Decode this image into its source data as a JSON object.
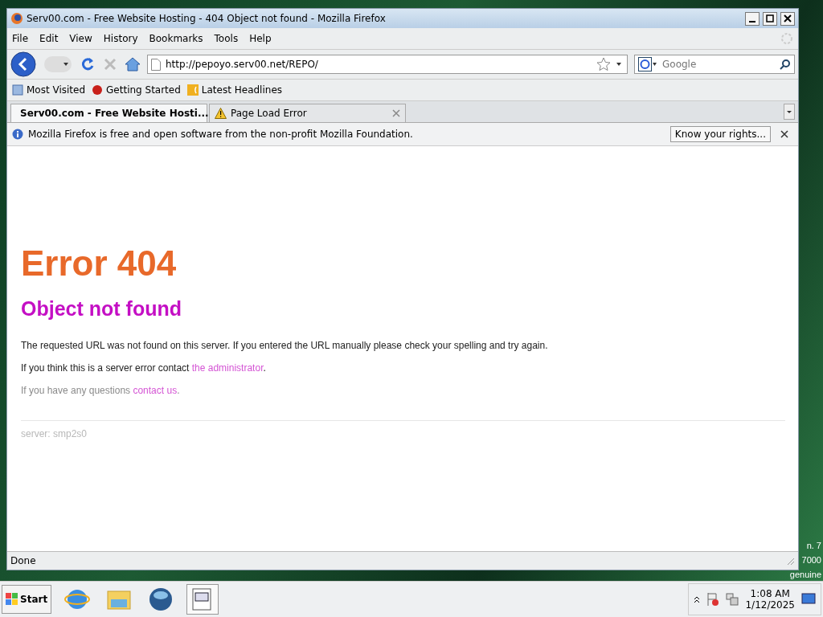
{
  "window": {
    "title": "Serv00.com - Free Website Hosting - 404 Object not found - Mozilla Firefox"
  },
  "menu": [
    "File",
    "Edit",
    "View",
    "History",
    "Bookmarks",
    "Tools",
    "Help"
  ],
  "address_bar": {
    "value": "http://pepoyo.serv00.net/REPO/"
  },
  "search": {
    "placeholder": "Google"
  },
  "bookmarks": [
    {
      "label": "Most Visited",
      "kind": "visited"
    },
    {
      "label": "Getting Started",
      "kind": "started"
    },
    {
      "label": "Latest Headlines",
      "kind": "feed"
    }
  ],
  "tabs": [
    {
      "label": "Serv00.com - Free Website Hosti...",
      "selected": true,
      "kind": "page"
    },
    {
      "label": "Page Load Error",
      "selected": false,
      "kind": "warning"
    }
  ],
  "notification": {
    "text": "Mozilla Firefox is free and open software from the non-profit Mozilla Foundation.",
    "button": "Know your rights..."
  },
  "page": {
    "heading": "Error 404",
    "subheading": "Object not found",
    "paragraphs": [
      {
        "text": "The requested URL was not found on this server. If you entered the URL manually please check your spelling and try again.",
        "muted": false
      },
      {
        "text": "If you think this is a server error contact ",
        "link": "the administrator",
        "after": ".",
        "muted": false
      },
      {
        "text": "If you have any questions ",
        "link": "contact us",
        "after": ".",
        "muted": true
      }
    ],
    "footer": "server: smp2s0"
  },
  "status_bar": {
    "text": "Done"
  },
  "desktop": {
    "lines": [
      "n. 7",
      "7000",
      "genuine"
    ]
  },
  "taskbar": {
    "start": "Start",
    "time": "1:08 AM",
    "date": "1/12/2025"
  }
}
